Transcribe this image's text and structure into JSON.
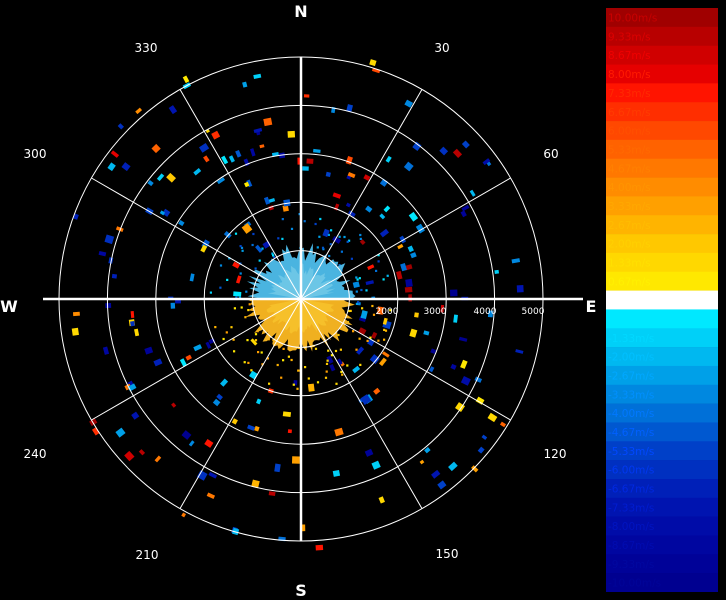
{
  "chart_data": {
    "type": "polar-radar",
    "compass": {
      "north": "N",
      "east": "E",
      "south": "S",
      "west": "W"
    },
    "azimuth_labels": [
      "30",
      "60",
      "120",
      "150",
      "210",
      "240",
      "300",
      "330"
    ],
    "range_labels": [
      "2000",
      "3000",
      "4000",
      "5000"
    ],
    "legend": {
      "entries": [
        {
          "label": "10.00m/s",
          "color": "#a00000",
          "text_color": "#c80000"
        },
        {
          "label": "9.33m/s",
          "color": "#b80000",
          "text_color": "#dc0000"
        },
        {
          "label": "8.67m/s",
          "color": "#d00000",
          "text_color": "#f00000"
        },
        {
          "label": "8.00m/s",
          "color": "#e60000",
          "text_color": "#ff1a00"
        },
        {
          "label": "7.33m/s",
          "color": "#ff1400",
          "text_color": "#ff2a00"
        },
        {
          "label": "6.67m/s",
          "color": "#ff2e00",
          "text_color": "#ff3c00"
        },
        {
          "label": "6.00m/s",
          "color": "#ff4800",
          "text_color": "#ff5000"
        },
        {
          "label": "5.33m/s",
          "color": "#ff6200",
          "text_color": "#ff6a00"
        },
        {
          "label": "4.67m/s",
          "color": "#ff7800",
          "text_color": "#ff8000"
        },
        {
          "label": "4.00m/s",
          "color": "#ff8c00",
          "text_color": "#ff9400"
        },
        {
          "label": "3.33m/s",
          "color": "#ffa000",
          "text_color": "#ffa800"
        },
        {
          "label": "2.67m/s",
          "color": "#ffb400",
          "text_color": "#ffbc00"
        },
        {
          "label": "2.00m/s",
          "color": "#ffc800",
          "text_color": "#ffd000"
        },
        {
          "label": "1.33m/s",
          "color": "#ffd800",
          "text_color": "#ffe000"
        },
        {
          "label": "0.67m/s",
          "color": "#ffe800",
          "text_color": "#fff000"
        },
        {
          "label": "0.00m/s",
          "color": "#ffffff",
          "text_color": "#ffffff"
        },
        {
          "label": "-0.67m/s",
          "color": "#00e8ff",
          "text_color": "#00e8ff"
        },
        {
          "label": "-1.33m/s",
          "color": "#00d0f8",
          "text_color": "#00d8ff"
        },
        {
          "label": "-2.00m/s",
          "color": "#00b8f0",
          "text_color": "#00c0ff"
        },
        {
          "label": "-2.67m/s",
          "color": "#00a0e8",
          "text_color": "#00a8ff"
        },
        {
          "label": "-3.33m/s",
          "color": "#0088e0",
          "text_color": "#0090ff"
        },
        {
          "label": "-4.00m/s",
          "color": "#0070d8",
          "text_color": "#0078ff"
        },
        {
          "label": "-4.67m/s",
          "color": "#0058d0",
          "text_color": "#0060ff"
        },
        {
          "label": "-5.33m/s",
          "color": "#0040c8",
          "text_color": "#0048ff"
        },
        {
          "label": "-6.00m/s",
          "color": "#0030c0",
          "text_color": "#0038f0"
        },
        {
          "label": "-6.67m/s",
          "color": "#0020b8",
          "text_color": "#0028e0"
        },
        {
          "label": "-7.33m/s",
          "color": "#0014b0",
          "text_color": "#001cd0"
        },
        {
          "label": "-8.00m/s",
          "color": "#000ca8",
          "text_color": "#0014c0"
        },
        {
          "label": "-8.67m/s",
          "color": "#0006a0",
          "text_color": "#000cb0"
        },
        {
          "label": "-9.33m/s",
          "color": "#000298",
          "text_color": "#0008a0"
        },
        {
          "label": "-10.00m/s",
          "color": "#000090",
          "text_color": "#000498"
        }
      ]
    },
    "grid": true,
    "colors": {
      "background": "#000000",
      "grid": "#ffffff",
      "approaching_core": "#4ab4e0",
      "receding_core": "#f0b020"
    }
  }
}
